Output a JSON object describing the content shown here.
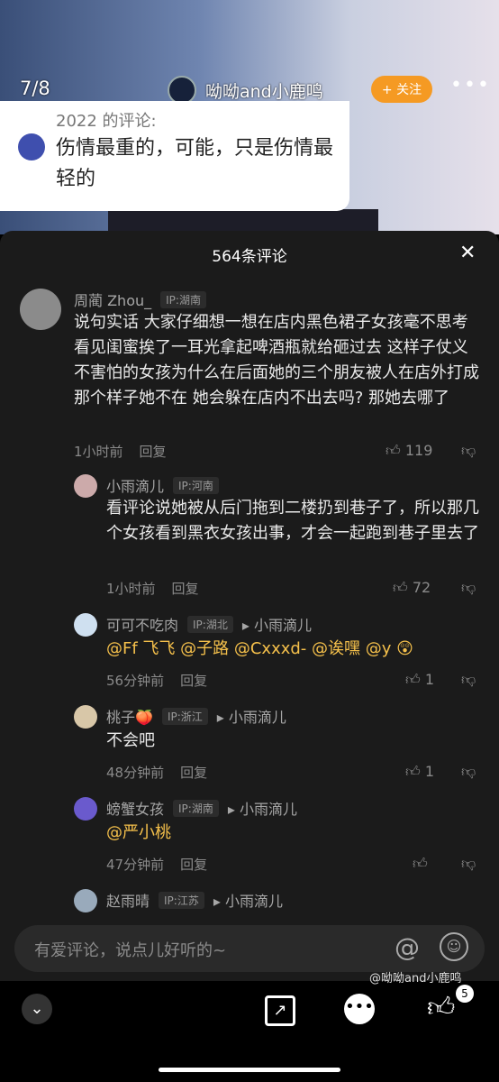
{
  "header": {
    "page_indicator": "7/8",
    "author": "呦呦and小鹿鸣",
    "follow_label": "+ 关注",
    "more_label": "•••"
  },
  "bubble": {
    "year_label": "2022 的评论:",
    "text": "伤情最重的，可能，只是伤情最轻的"
  },
  "sheet": {
    "title": "564条评论",
    "close_label": "✕"
  },
  "comments": [
    {
      "name": "周蔺 Zhou_",
      "ip": "IP:湖南",
      "body": "说句实话 大家仔细想一想在店内黑色裙子女孩毫不思考 看见闺蜜挨了一耳光拿起啤酒瓶就给砸过去 这样子仗义不害怕的女孩为什么在后面她的三个朋友被人在店外打成那个样子她不在 她会躲在店内不出去吗? 那她去哪了",
      "time": "1小时前",
      "reply": "回复",
      "likes": "119"
    },
    {
      "name": "小雨滴儿",
      "ip": "IP:河南",
      "body": "看评论说她被从后门拖到二楼扔到巷子了，所以那几个女孩看到黑衣女孩出事，才会一起跑到巷子里去了",
      "time": "1小时前",
      "reply": "回复",
      "likes": "72"
    },
    {
      "name": "可可不吃肉",
      "ip": "IP:湖北",
      "reply_to": "小雨滴儿",
      "body": "@Ff 飞飞 @子路 @Cxxxd- @诶嘿 @y 😲",
      "time": "56分钟前",
      "reply": "回复",
      "likes": "1"
    },
    {
      "name": "桃子🍑",
      "ip": "IP:浙江",
      "reply_to": "小雨滴儿",
      "body": "不会吧",
      "time": "48分钟前",
      "reply": "回复",
      "likes": "1"
    },
    {
      "name": "螃蟹女孩",
      "ip": "IP:湖南",
      "reply_to": "小雨滴儿",
      "body": "@严小桃",
      "time": "47分钟前",
      "reply": "回复",
      "likes": ""
    },
    {
      "name": "赵雨晴",
      "ip": "IP:江苏",
      "reply_to": "小雨滴儿"
    }
  ],
  "input": {
    "placeholder": "有爱评论，说点儿好听的~",
    "at_label": "@",
    "emoji_label": "☺"
  },
  "bottom": {
    "like_count": "5",
    "watermark": "@呦呦and小鹿鸣"
  },
  "colors": {
    "follow": "#f59a23",
    "mention": "#f5c04b",
    "sheet": "#1b1b1b"
  }
}
